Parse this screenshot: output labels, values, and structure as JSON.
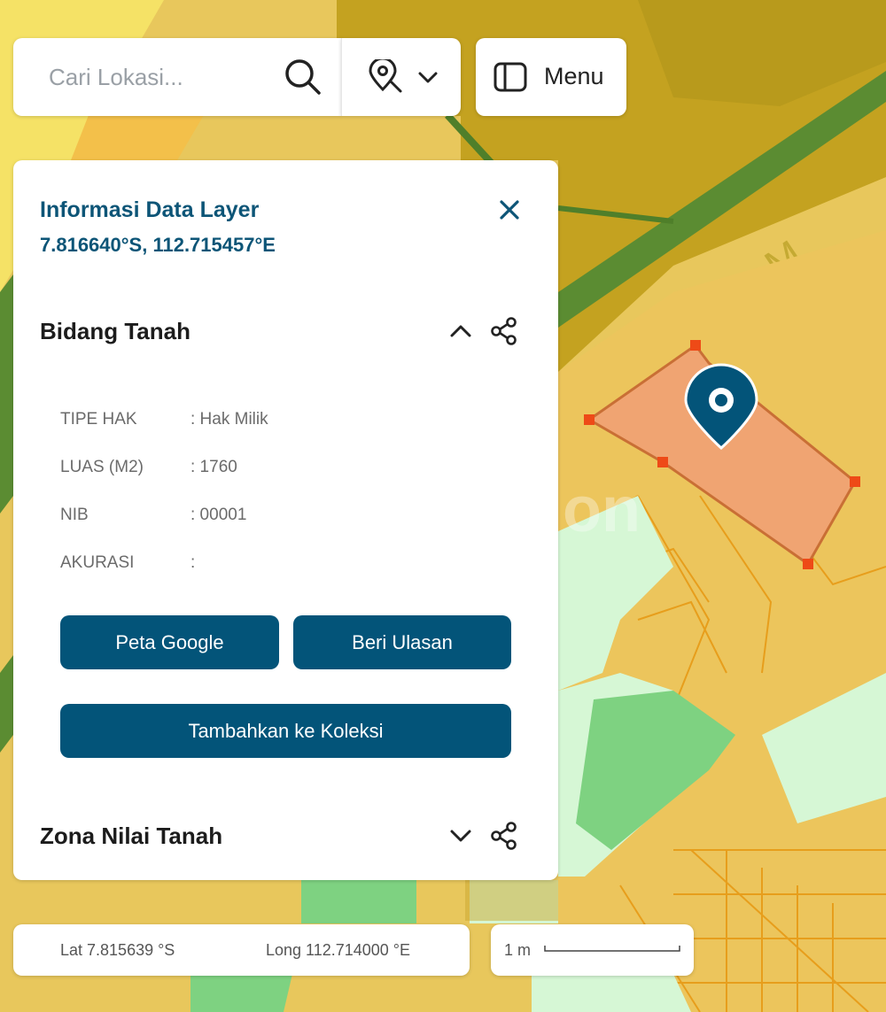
{
  "search": {
    "placeholder": "Cari Lokasi..."
  },
  "toolbar": {
    "menu_label": "Menu"
  },
  "info_panel": {
    "title": "Informasi Data Layer",
    "coordinates": "7.816640°S, 112.715457°E",
    "sections": [
      {
        "title": "Bidang Tanah",
        "expanded": true,
        "rows": [
          {
            "label": "TIPE HAK",
            "value": ": Hak Milik"
          },
          {
            "label": "LUAS (M2)",
            "value": ": 1760"
          },
          {
            "label": "NIB",
            "value": ": 00001"
          },
          {
            "label": "AKURASI",
            "value": ":"
          }
        ],
        "buttons": {
          "google_map": "Peta Google",
          "review": "Beri Ulasan",
          "add_collection": "Tambahkan ke Koleksi"
        }
      },
      {
        "title": "Zona Nilai Tanah",
        "expanded": false
      }
    ]
  },
  "map": {
    "road_label": "Surabaya - M",
    "watermark": "on"
  },
  "status_bar": {
    "lat": "Lat 7.815639 °S",
    "long": "Long 112.714000 °E",
    "scale": "1 m"
  },
  "colors": {
    "primary": "#035479",
    "title_blue": "#0d5577",
    "parcel_fill": "#f0a472",
    "parcel_vertex": "#ee4a17",
    "map_yellow": "#e8c75c",
    "map_olive": "#c4a220",
    "map_green": "#7ed281",
    "map_light_green": "#d6f7d5",
    "road_green": "#5b8c32"
  },
  "icons": [
    "search-icon",
    "locate-pin-icon",
    "chevron-down-icon",
    "sidebar-panel-icon",
    "close-icon",
    "chevron-up-icon",
    "share-icon",
    "location-marker-icon"
  ]
}
